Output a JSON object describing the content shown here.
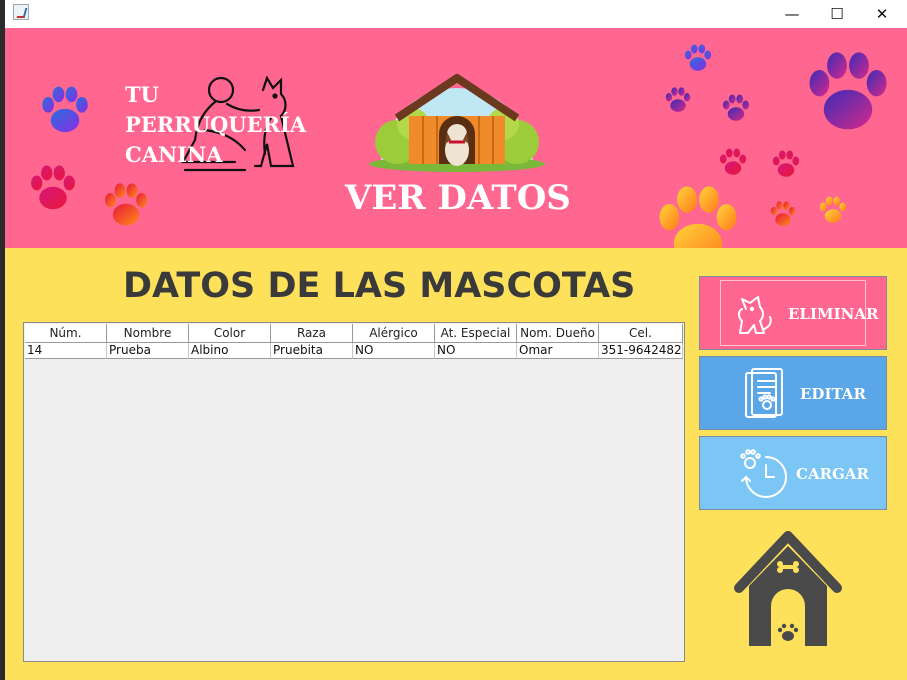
{
  "window": {
    "controls": {
      "minimize": "—",
      "maximize": "☐",
      "close": "✕"
    }
  },
  "header": {
    "brand_text": "TU\nPERRUQUERÍA\nCANINA",
    "title": "VER DATOS"
  },
  "main": {
    "section_title": "DATOS DE LAS MASCOTAS",
    "table": {
      "columns": [
        "Núm.",
        "Nombre",
        "Color",
        "Raza",
        "Alérgico",
        "At. Especial",
        "Nom. Dueño",
        "Cel."
      ],
      "rows": [
        [
          "14",
          "Prueba",
          "Albino",
          "Pruebita",
          "NO",
          "NO",
          "Omar",
          "351-9642482"
        ]
      ]
    }
  },
  "actions": {
    "eliminar": "ELIMINAR",
    "editar": "EDITAR",
    "cargar": "CARGAR"
  },
  "colors": {
    "header_pink": "#ff6690",
    "body_yellow": "#fee15a",
    "btn_eliminar": "#ff6690",
    "btn_editar": "#5aa6e6",
    "btn_cargar": "#7cc6f6",
    "title_dark": "#3a3a3a"
  },
  "icons": {
    "app": "java-app-icon",
    "brand": "person-hugging-dog-icon",
    "kennel_header": "dog-in-kennel-icon",
    "paws": "paw-print-icon",
    "eliminar": "dog-icon",
    "editar": "clipboard-paw-icon",
    "cargar": "paw-clock-icon",
    "kennel_footer": "dog-house-icon"
  }
}
